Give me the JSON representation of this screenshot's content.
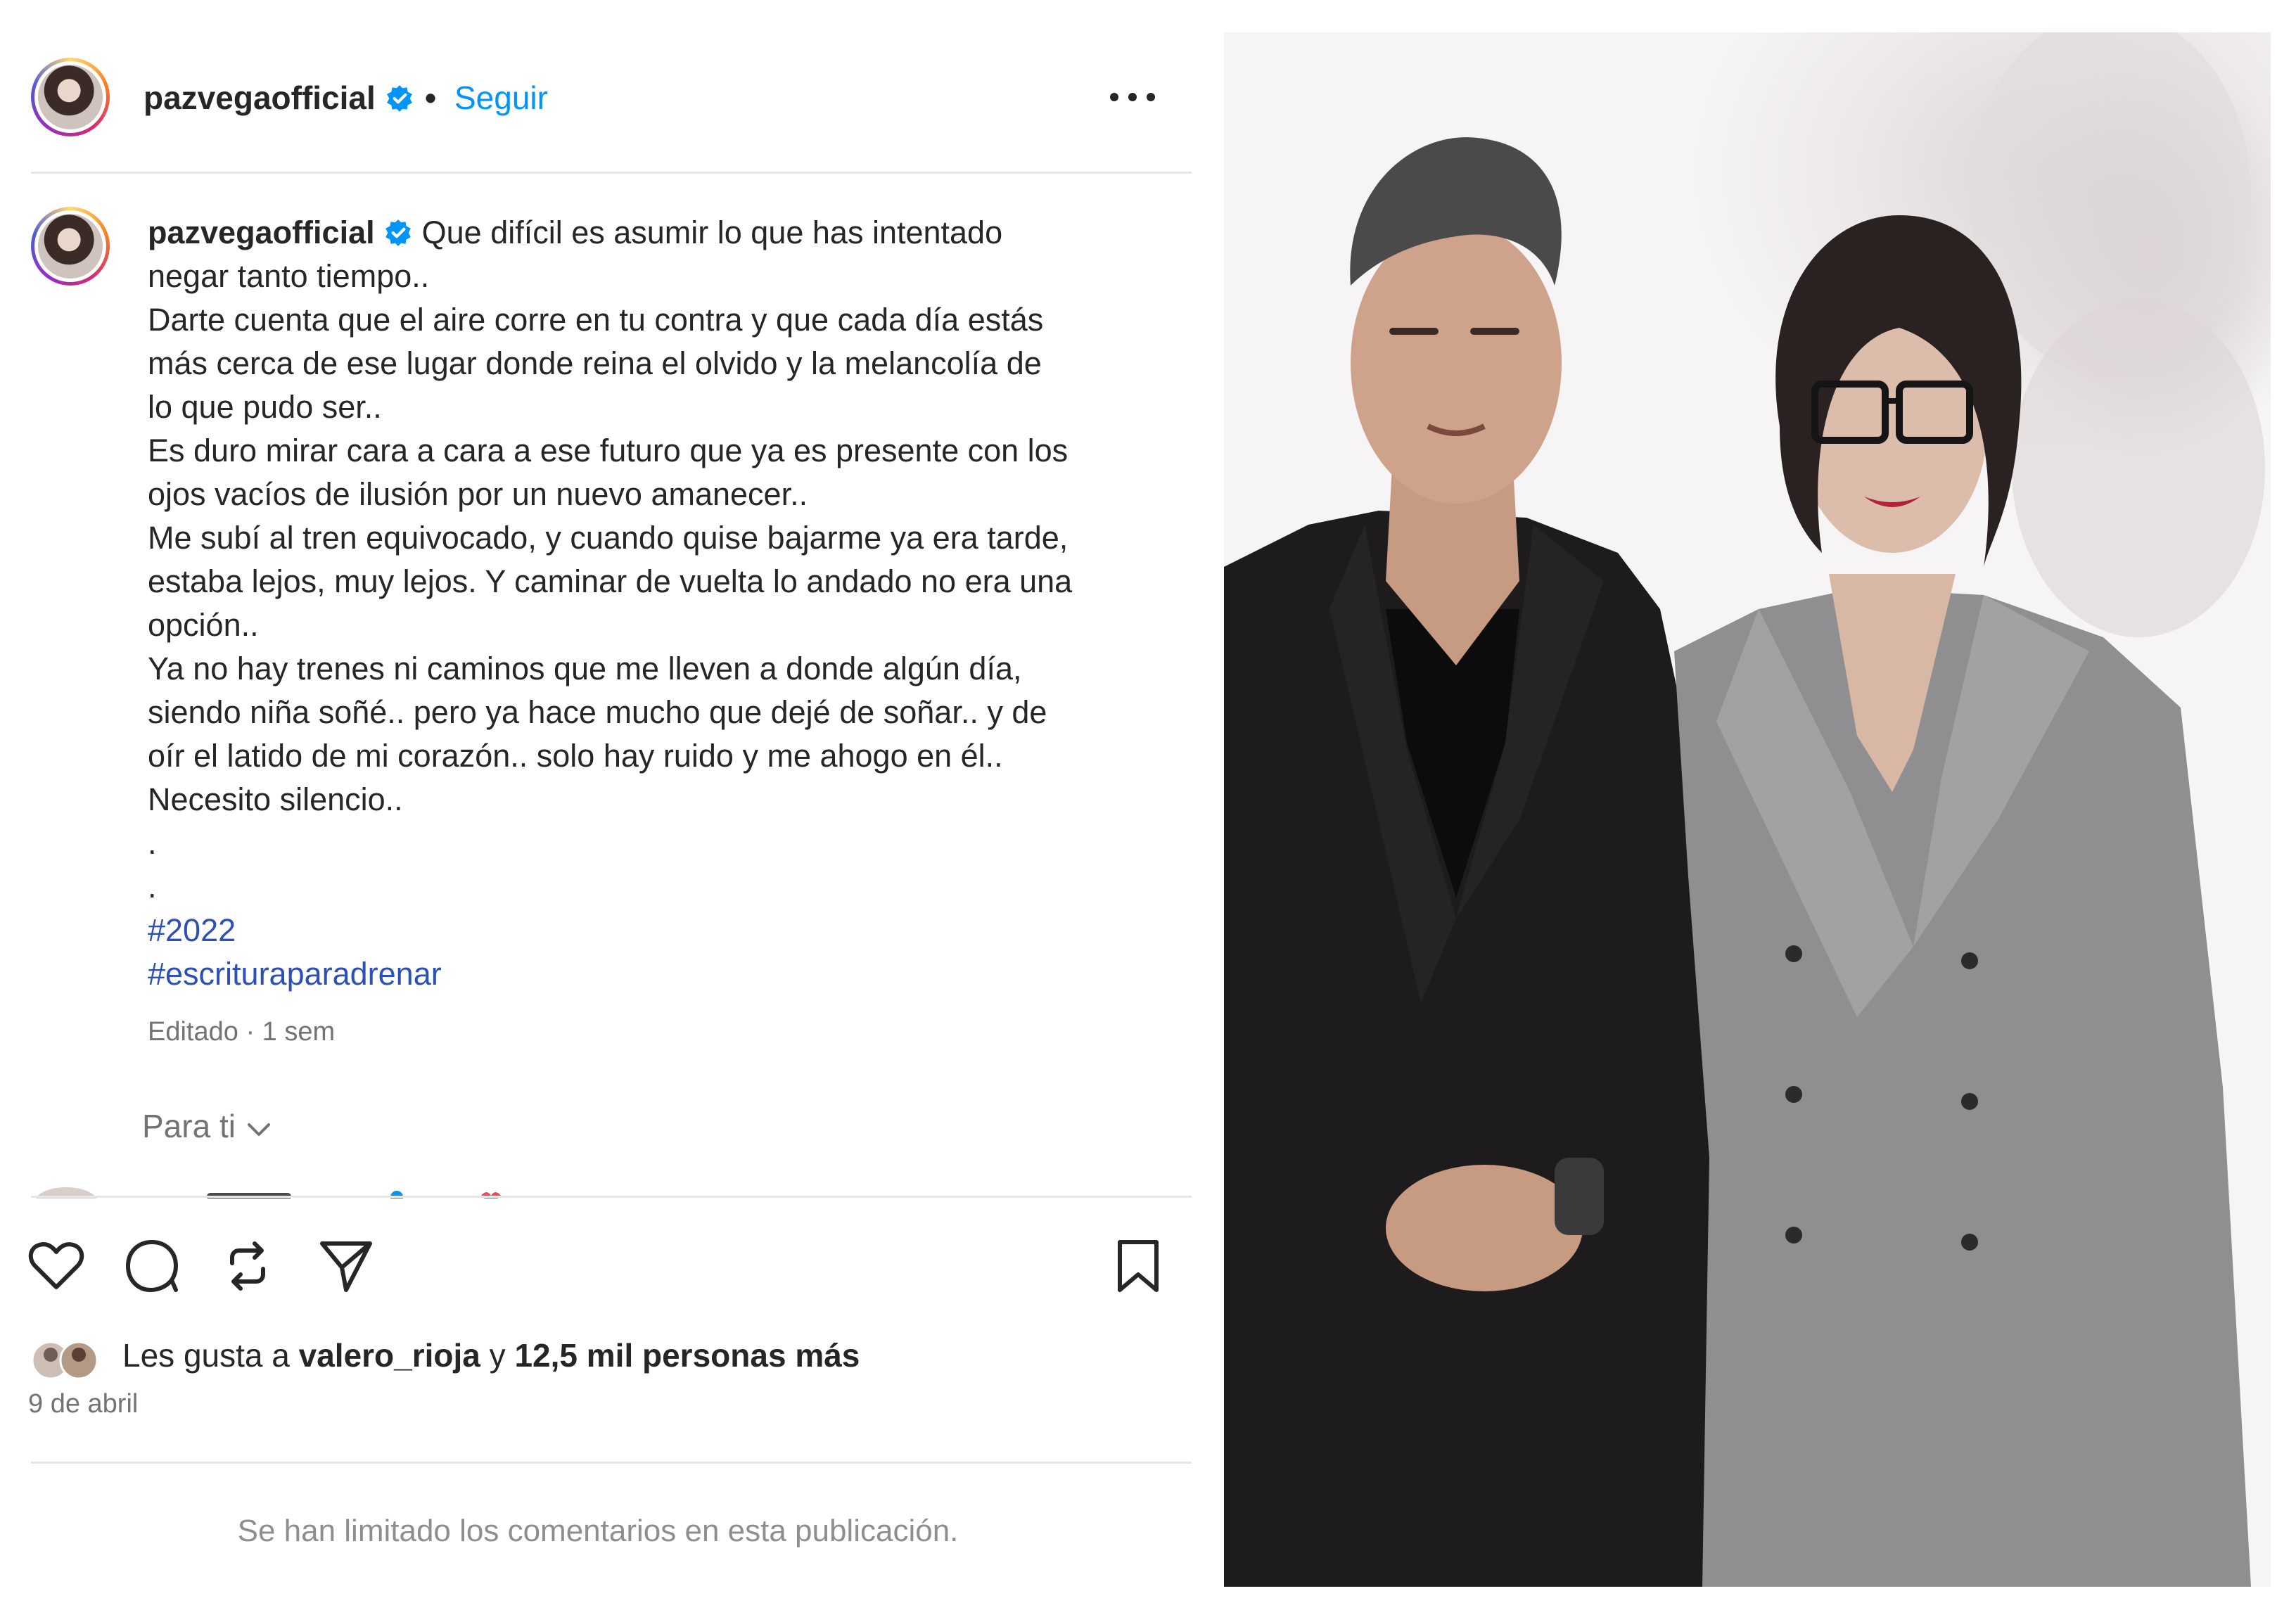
{
  "post_header": {
    "username": "pazvegaofficial",
    "separator": "•",
    "follow_label": "Seguir"
  },
  "caption": {
    "username": "pazvegaofficial",
    "lines": [
      "Que difícil es asumir lo que has intentado",
      "negar tanto tiempo..",
      "Darte cuenta que el aire corre en tu contra y que cada día estás",
      "más cerca de ese lugar donde reina el olvido y la melancolía de",
      "lo que pudo ser..",
      "Es duro mirar cara a cara a ese futuro que ya es presente con los",
      "ojos vacíos de ilusión por un nuevo amanecer..",
      "Me subí al tren equivocado, y cuando quise bajarme ya era tarde,",
      "estaba lejos, muy lejos. Y caminar de vuelta lo andado no era una",
      "opción..",
      "Ya no hay trenes ni caminos que me lleven a donde algún día,",
      "siendo niña soñé.. pero ya hace mucho que dejé de soñar.. y de",
      "oír el latido de mi corazón.. solo hay ruido y me ahogo en él..",
      "Necesito silencio..",
      ".",
      "."
    ],
    "hashtags": [
      "#2022",
      "#escrituraparadrenar"
    ],
    "meta": "Editado · 1 sem"
  },
  "comments_filter": {
    "label": "Para ti"
  },
  "actions": {
    "icons": [
      "heart-icon",
      "comment-icon",
      "repost-icon",
      "share-icon",
      "bookmark-icon"
    ]
  },
  "likes": {
    "prefix": "Les gusta a",
    "user": "valero_rioja",
    "connector": "y",
    "others": "12,5 mil personas más"
  },
  "date": "9 de abril",
  "comments_notice": "Se han limitado los comentarios en esta publicación.",
  "colors": {
    "link_blue": "#0095f6",
    "hashtag_blue": "#2d4fb8",
    "verified_blue": "#0095f6",
    "muted_gray": "#737373"
  }
}
